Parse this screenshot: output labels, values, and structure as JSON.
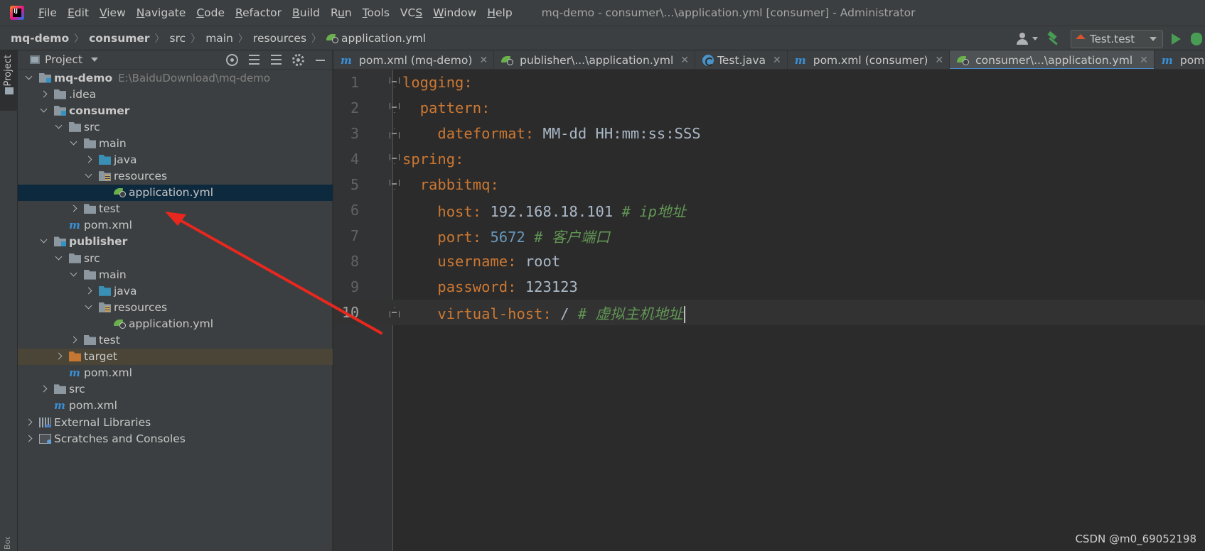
{
  "menubar": {
    "items": [
      {
        "label": "File",
        "mnemonic": "F"
      },
      {
        "label": "Edit",
        "mnemonic": "E"
      },
      {
        "label": "View",
        "mnemonic": "V"
      },
      {
        "label": "Navigate",
        "mnemonic": "N"
      },
      {
        "label": "Code",
        "mnemonic": "C"
      },
      {
        "label": "Refactor",
        "mnemonic": "R"
      },
      {
        "label": "Build",
        "mnemonic": "B"
      },
      {
        "label": "Run",
        "mnemonic": "u"
      },
      {
        "label": "Tools",
        "mnemonic": "T"
      },
      {
        "label": "VCS",
        "mnemonic": "S"
      },
      {
        "label": "Window",
        "mnemonic": "W"
      },
      {
        "label": "Help",
        "mnemonic": "H"
      }
    ],
    "window_title": "mq-demo - consumer\\...\\application.yml [consumer] - Administrator"
  },
  "breadcrumb": [
    "mq-demo",
    "consumer",
    "src",
    "main",
    "resources",
    "application.yml"
  ],
  "run_config": {
    "label": "Test.test"
  },
  "toolstrip": {
    "project_label": "Project",
    "bottom_label": "Bookmarks"
  },
  "project_panel": {
    "title": "Project",
    "tree": [
      {
        "label": "mq-demo",
        "path": "E:\\BaiduDownload\\mq-demo",
        "depth": 0,
        "arrow": "down",
        "icon": "module",
        "bold": true
      },
      {
        "label": ".idea",
        "depth": 1,
        "arrow": "right",
        "icon": "folder"
      },
      {
        "label": "consumer",
        "depth": 1,
        "arrow": "down",
        "icon": "module",
        "bold": true
      },
      {
        "label": "src",
        "depth": 2,
        "arrow": "down",
        "icon": "folder"
      },
      {
        "label": "main",
        "depth": 3,
        "arrow": "down",
        "icon": "folder"
      },
      {
        "label": "java",
        "depth": 4,
        "arrow": "right",
        "icon": "src"
      },
      {
        "label": "resources",
        "depth": 4,
        "arrow": "down",
        "icon": "res"
      },
      {
        "label": "application.yml",
        "depth": 5,
        "arrow": "none",
        "icon": "yml",
        "selected": true
      },
      {
        "label": "test",
        "depth": 3,
        "arrow": "right",
        "icon": "folder"
      },
      {
        "label": "pom.xml",
        "depth": 2,
        "arrow": "none",
        "icon": "maven"
      },
      {
        "label": "publisher",
        "depth": 1,
        "arrow": "down",
        "icon": "module",
        "bold": true
      },
      {
        "label": "src",
        "depth": 2,
        "arrow": "down",
        "icon": "folder"
      },
      {
        "label": "main",
        "depth": 3,
        "arrow": "down",
        "icon": "folder"
      },
      {
        "label": "java",
        "depth": 4,
        "arrow": "right",
        "icon": "src"
      },
      {
        "label": "resources",
        "depth": 4,
        "arrow": "down",
        "icon": "res"
      },
      {
        "label": "application.yml",
        "depth": 5,
        "arrow": "none",
        "icon": "yml"
      },
      {
        "label": "test",
        "depth": 3,
        "arrow": "right",
        "icon": "folder"
      },
      {
        "label": "target",
        "depth": 2,
        "arrow": "right",
        "icon": "target",
        "excluded": true
      },
      {
        "label": "pom.xml",
        "depth": 2,
        "arrow": "none",
        "icon": "maven"
      },
      {
        "label": "src",
        "depth": 1,
        "arrow": "right",
        "icon": "folder"
      },
      {
        "label": "pom.xml",
        "depth": 1,
        "arrow": "none",
        "icon": "maven"
      },
      {
        "label": "External Libraries",
        "depth": 0,
        "arrow": "right",
        "icon": "libs"
      },
      {
        "label": "Scratches and Consoles",
        "depth": 0,
        "arrow": "right",
        "icon": "scratch"
      }
    ]
  },
  "tabs": [
    {
      "label": "pom.xml (mq-demo)",
      "icon": "maven"
    },
    {
      "label": "publisher\\...\\application.yml",
      "icon": "yml"
    },
    {
      "label": "Test.java",
      "icon": "java"
    },
    {
      "label": "pom.xml (consumer)",
      "icon": "maven"
    },
    {
      "label": "consumer\\...\\application.yml",
      "icon": "yml",
      "active": true
    },
    {
      "label": "pom.xml",
      "icon": "maven"
    }
  ],
  "editor": {
    "current_line": 10,
    "lines": [
      {
        "n": "1",
        "fold": "open",
        "parts": [
          {
            "t": "logging",
            "c": "k"
          },
          {
            "t": ":",
            "c": "p"
          }
        ]
      },
      {
        "n": "2",
        "fold": "open",
        "parts": [
          {
            "t": "  "
          },
          {
            "t": "pattern",
            "c": "k"
          },
          {
            "t": ":",
            "c": "p"
          }
        ]
      },
      {
        "n": "3",
        "fold": "close",
        "parts": [
          {
            "t": "    "
          },
          {
            "t": "dateformat",
            "c": "k"
          },
          {
            "t": ": ",
            "c": "p"
          },
          {
            "t": "MM-dd HH:mm:ss:SSS",
            "c": "v"
          }
        ]
      },
      {
        "n": "4",
        "fold": "open",
        "parts": [
          {
            "t": "spring",
            "c": "k"
          },
          {
            "t": ":",
            "c": "p"
          }
        ]
      },
      {
        "n": "5",
        "fold": "open",
        "parts": [
          {
            "t": "  "
          },
          {
            "t": "rabbitmq",
            "c": "k"
          },
          {
            "t": ":",
            "c": "p"
          }
        ]
      },
      {
        "n": "6",
        "fold": "",
        "parts": [
          {
            "t": "    "
          },
          {
            "t": "host",
            "c": "k"
          },
          {
            "t": ": ",
            "c": "p"
          },
          {
            "t": "192.168.18.101 ",
            "c": "v"
          },
          {
            "t": "# ip地址",
            "c": "c"
          }
        ]
      },
      {
        "n": "7",
        "fold": "",
        "parts": [
          {
            "t": "    "
          },
          {
            "t": "port",
            "c": "k"
          },
          {
            "t": ": ",
            "c": "p"
          },
          {
            "t": "5672 ",
            "c": "n"
          },
          {
            "t": "# 客户端口",
            "c": "c"
          }
        ]
      },
      {
        "n": "8",
        "fold": "",
        "parts": [
          {
            "t": "    "
          },
          {
            "t": "username",
            "c": "k"
          },
          {
            "t": ": ",
            "c": "p"
          },
          {
            "t": "root",
            "c": "v"
          }
        ]
      },
      {
        "n": "9",
        "fold": "",
        "parts": [
          {
            "t": "    "
          },
          {
            "t": "password",
            "c": "k"
          },
          {
            "t": ": ",
            "c": "p"
          },
          {
            "t": "123123",
            "c": "v"
          }
        ]
      },
      {
        "n": "10",
        "fold": "close",
        "parts": [
          {
            "t": "    "
          },
          {
            "t": "virtual-host",
            "c": "k"
          },
          {
            "t": ": ",
            "c": "p"
          },
          {
            "t": "/ ",
            "c": "v"
          },
          {
            "t": "# 虚拟主机地址",
            "c": "c"
          }
        ]
      }
    ]
  },
  "watermark": "CSDN @m0_69052198",
  "colors": {
    "annotation_arrow": "#e8281e",
    "selection": "#0d293e",
    "keyword": "#cc7832",
    "comment": "#629755",
    "number": "#6897bb"
  }
}
